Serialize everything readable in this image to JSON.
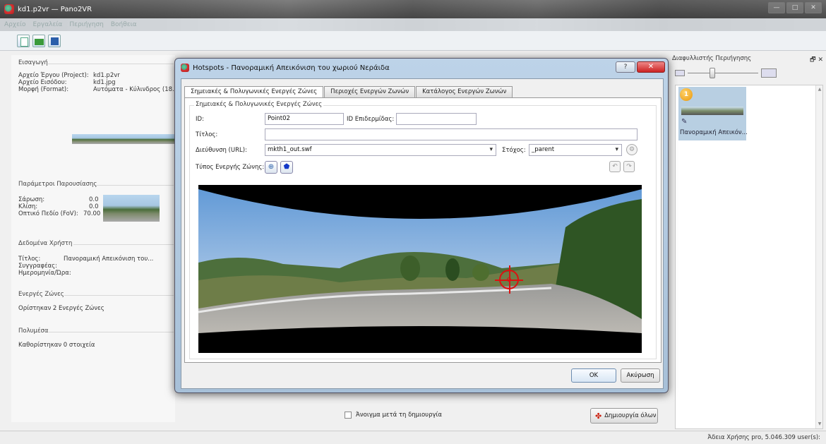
{
  "window": {
    "title": "kd1.p2vr — Pano2VR",
    "buttons": [
      "—",
      "□",
      "✕"
    ]
  },
  "menu": [
    "Αρχείο",
    "Εργαλεία",
    "Περιήγηση",
    "Βοήθεια"
  ],
  "left": {
    "input": {
      "title": "Εισαγωγή",
      "project_label": "Αρχείο Έργου (Project):",
      "project_value": "kd1.p2vr",
      "input_label": "Αρχείο Εισόδου:",
      "input_value": "kd1.jpg",
      "format_label": "Μορφή (Format):",
      "format_value": "Αυτόματα - Κύλινδρος (18..."
    },
    "display": {
      "title": "Παράμετροι Παρουσίασης",
      "pan_label": "Σάρωση:",
      "pan_value": "0.0",
      "tilt_label": "Κλίση:",
      "tilt_value": "0.0",
      "fov_label": "Οπτικό Πεδίο (FoV):",
      "fov_value": "70.00"
    },
    "user": {
      "title": "Δεδομένα Χρήστη",
      "title_label": "Τίτλος:",
      "title_value": "Πανοραμική Απεικόνιση του...",
      "author_label": "Συγγραφέας:",
      "date_label": "Ημερομηνία/Ώρα:"
    },
    "hotspots": {
      "title": "Ενεργές Ζώνες",
      "text": "Ορίστηκαν 2 Ενεργές Ζώνες"
    },
    "media": {
      "title": "Πολυμέσα",
      "text": "Καθορίστηκαν 0 στοιχεία"
    }
  },
  "right": {
    "title": "Διαφυλλιστής Περιήγησης",
    "close": "🗗 ✕",
    "zoom_level": 0.35,
    "node_number": "1",
    "node_label": "Πανοραμική Απεικόν..."
  },
  "bottom": {
    "open_after": "Άνοιγμα μετά τη δημιουργία",
    "create_all": "Δημιουργία όλων",
    "status": "Άδεια Χρήσης pro, 5.046.309 user(s):"
  },
  "dialog": {
    "title": "Hotspots - Πανοραμική Απεικόνιση του χωριού Νεράιδα",
    "help": "?",
    "close": "✕",
    "tabs": [
      "Σημειακές & Πολυγωνικές Ενεργές Ζώνες",
      "Περιοχές Ενεργών Ζωνών",
      "Κατάλογος Ενεργών Ζωνών"
    ],
    "legend": "Σημειακές & Πολυγωνικές Ενεργές Ζώνες",
    "id_label": "ID:",
    "id_value": "Point02",
    "skin_id_label": "ID Επιδερμίδας:",
    "skin_id_value": "",
    "title_label": "Τίτλος:",
    "title_value": "",
    "url_label": "Διεύθυνση (URL):",
    "url_value": "mkth1_out.swf",
    "target_label": "Στόχος:",
    "target_value": "_parent",
    "type_label": "Τύπος Ενεργής Ζώνης:",
    "ok": "OK",
    "cancel": "Ακύρωση"
  },
  "colors": {
    "hotspot_marker": "#dd1111",
    "dialog_frame": "#a7c0d8",
    "close_button": "#cc2222"
  },
  "icons": [
    "new-project-icon",
    "open-project-icon",
    "save-project-icon",
    "gear-icon",
    "point-hotspot-icon",
    "polygon-hotspot-icon",
    "undo-icon",
    "redo-icon",
    "crosshair-icon"
  ]
}
